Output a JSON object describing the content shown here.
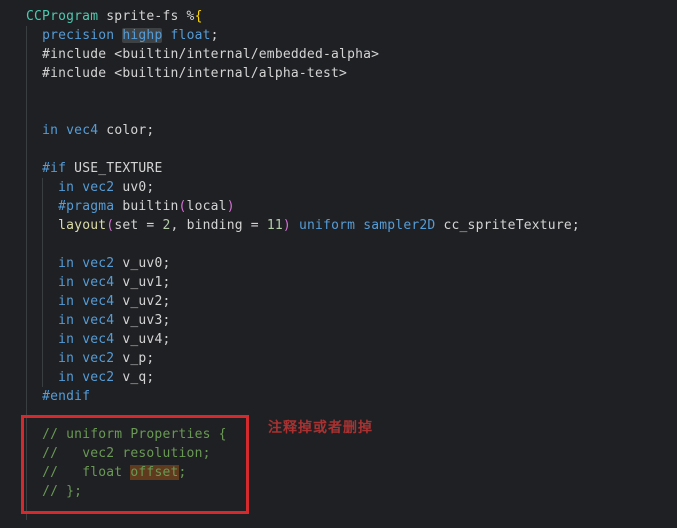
{
  "editor": {
    "background": "#1f2023",
    "colors": {
      "keyword": "#569CD6",
      "type": "#4EC9B0",
      "text": "#D4D4D4",
      "function": "#DCDCAA",
      "number": "#B5CEA8",
      "bracket_gold": "#FFD700",
      "bracket_pink": "#D670D6",
      "comment": "#6A9955",
      "word_highlight_bg": "#3e4245",
      "find_highlight_bg": "#5f3a1d",
      "indent_guide": "#3b3e41",
      "annotation_red": "#d42a2e",
      "annotation_text_red": "#a83232"
    },
    "lines": [
      {
        "tokens": [
          {
            "t": "CCProgram",
            "c": "type"
          },
          {
            "t": " sprite-fs ",
            "c": "text"
          },
          {
            "t": "%",
            "c": "text"
          },
          {
            "t": "{",
            "c": "b1"
          }
        ]
      },
      {
        "tokens": [
          {
            "t": "  ",
            "c": "text"
          },
          {
            "t": "precision",
            "c": "keyword"
          },
          {
            "t": " ",
            "c": "text"
          },
          {
            "t": "highp",
            "c": "keyword",
            "h": "word"
          },
          {
            "t": " ",
            "c": "text"
          },
          {
            "t": "float",
            "c": "keyword"
          },
          {
            "t": ";",
            "c": "text"
          }
        ]
      },
      {
        "tokens": [
          {
            "t": "  #include <builtin/internal/embedded-alpha>",
            "c": "text"
          }
        ]
      },
      {
        "tokens": [
          {
            "t": "  #include <builtin/internal/alpha-test>",
            "c": "text"
          }
        ]
      },
      {
        "tokens": []
      },
      {
        "tokens": []
      },
      {
        "tokens": [
          {
            "t": "  ",
            "c": "text"
          },
          {
            "t": "in",
            "c": "keyword"
          },
          {
            "t": " ",
            "c": "text"
          },
          {
            "t": "vec4",
            "c": "keyword"
          },
          {
            "t": " color;",
            "c": "text"
          }
        ]
      },
      {
        "tokens": []
      },
      {
        "tokens": [
          {
            "t": "  ",
            "c": "text"
          },
          {
            "t": "#if",
            "c": "keyword"
          },
          {
            "t": " USE_TEXTURE",
            "c": "text"
          }
        ]
      },
      {
        "tokens": [
          {
            "t": "    ",
            "c": "text"
          },
          {
            "t": "in",
            "c": "keyword"
          },
          {
            "t": " ",
            "c": "text"
          },
          {
            "t": "vec2",
            "c": "keyword"
          },
          {
            "t": " uv0;",
            "c": "text"
          }
        ]
      },
      {
        "tokens": [
          {
            "t": "    ",
            "c": "text"
          },
          {
            "t": "#pragma",
            "c": "keyword"
          },
          {
            "t": " builtin",
            "c": "text"
          },
          {
            "t": "(",
            "c": "b2"
          },
          {
            "t": "local",
            "c": "text"
          },
          {
            "t": ")",
            "c": "b2"
          }
        ]
      },
      {
        "tokens": [
          {
            "t": "    ",
            "c": "text"
          },
          {
            "t": "layout",
            "c": "func"
          },
          {
            "t": "(",
            "c": "b2"
          },
          {
            "t": "set = ",
            "c": "text"
          },
          {
            "t": "2",
            "c": "num"
          },
          {
            "t": ", binding = ",
            "c": "text"
          },
          {
            "t": "11",
            "c": "num"
          },
          {
            "t": ")",
            "c": "b2"
          },
          {
            "t": " ",
            "c": "text"
          },
          {
            "t": "uniform",
            "c": "keyword"
          },
          {
            "t": " ",
            "c": "text"
          },
          {
            "t": "sampler2D",
            "c": "keyword"
          },
          {
            "t": " cc_spriteTexture;",
            "c": "text"
          }
        ]
      },
      {
        "tokens": []
      },
      {
        "tokens": [
          {
            "t": "    ",
            "c": "text"
          },
          {
            "t": "in",
            "c": "keyword"
          },
          {
            "t": " ",
            "c": "text"
          },
          {
            "t": "vec2",
            "c": "keyword"
          },
          {
            "t": " v_uv0;",
            "c": "text"
          }
        ]
      },
      {
        "tokens": [
          {
            "t": "    ",
            "c": "text"
          },
          {
            "t": "in",
            "c": "keyword"
          },
          {
            "t": " ",
            "c": "text"
          },
          {
            "t": "vec4",
            "c": "keyword"
          },
          {
            "t": " v_uv1;",
            "c": "text"
          }
        ]
      },
      {
        "tokens": [
          {
            "t": "    ",
            "c": "text"
          },
          {
            "t": "in",
            "c": "keyword"
          },
          {
            "t": " ",
            "c": "text"
          },
          {
            "t": "vec4",
            "c": "keyword"
          },
          {
            "t": " v_uv2;",
            "c": "text"
          }
        ]
      },
      {
        "tokens": [
          {
            "t": "    ",
            "c": "text"
          },
          {
            "t": "in",
            "c": "keyword"
          },
          {
            "t": " ",
            "c": "text"
          },
          {
            "t": "vec4",
            "c": "keyword"
          },
          {
            "t": " v_uv3;",
            "c": "text"
          }
        ]
      },
      {
        "tokens": [
          {
            "t": "    ",
            "c": "text"
          },
          {
            "t": "in",
            "c": "keyword"
          },
          {
            "t": " ",
            "c": "text"
          },
          {
            "t": "vec4",
            "c": "keyword"
          },
          {
            "t": " v_uv4;",
            "c": "text"
          }
        ]
      },
      {
        "tokens": [
          {
            "t": "    ",
            "c": "text"
          },
          {
            "t": "in",
            "c": "keyword"
          },
          {
            "t": " ",
            "c": "text"
          },
          {
            "t": "vec2",
            "c": "keyword"
          },
          {
            "t": " v_p;",
            "c": "text"
          }
        ]
      },
      {
        "tokens": [
          {
            "t": "    ",
            "c": "text"
          },
          {
            "t": "in",
            "c": "keyword"
          },
          {
            "t": " ",
            "c": "text"
          },
          {
            "t": "vec2",
            "c": "keyword"
          },
          {
            "t": " v_q;",
            "c": "text"
          }
        ]
      },
      {
        "tokens": [
          {
            "t": "  ",
            "c": "text"
          },
          {
            "t": "#endif",
            "c": "keyword"
          }
        ]
      },
      {
        "tokens": []
      },
      {
        "tokens": [
          {
            "t": "  ",
            "c": "text"
          },
          {
            "t": "// uniform Properties {",
            "c": "comment"
          }
        ]
      },
      {
        "tokens": [
          {
            "t": "  ",
            "c": "text"
          },
          {
            "t": "//   vec2 resolution;",
            "c": "comment"
          }
        ]
      },
      {
        "tokens": [
          {
            "t": "  ",
            "c": "text"
          },
          {
            "t": "//   float ",
            "c": "comment"
          },
          {
            "t": "offset",
            "c": "comment",
            "h": "find"
          },
          {
            "t": ";",
            "c": "comment"
          }
        ]
      },
      {
        "tokens": [
          {
            "t": "  ",
            "c": "text"
          },
          {
            "t": "// };",
            "c": "comment"
          }
        ]
      },
      {
        "tokens": []
      }
    ],
    "annotation": {
      "label": "注释掉或者删掉"
    }
  }
}
